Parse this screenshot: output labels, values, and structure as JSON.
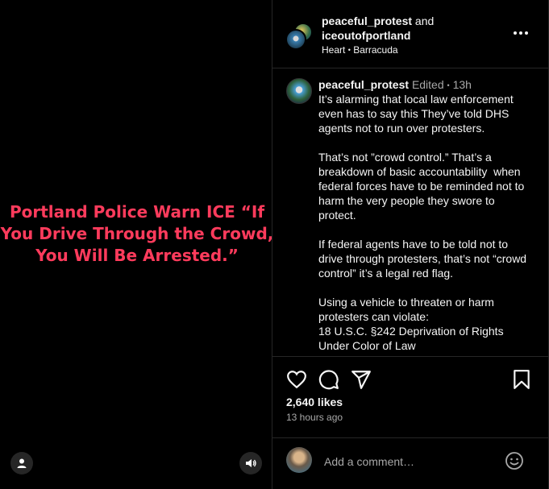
{
  "media": {
    "headline": "Portland Police Warn ICE “If You Drive Through the Crowd, You Will Be Arrested.”",
    "headline_color": "#ff3b5c",
    "icons": [
      "user-tag-icon",
      "speaker-icon"
    ]
  },
  "header": {
    "user1": "peaceful_protest",
    "joiner": " and",
    "user2": "iceoutofportland",
    "audio_artist": "Heart",
    "separator": "•",
    "audio_track": "Barracuda",
    "more_label": "•••"
  },
  "caption": {
    "username": "peaceful_protest",
    "edited": "Edited",
    "dot": "•",
    "age": "13h",
    "text": "It’s alarming that local law enforcement even has to say this They’ve told DHS agents not to run over protesters.\n\nThat’s not ”crowd control.” That’s a breakdown of basic accountability  when federal forces have to be reminded not to harm the very people they swore to protect.\n\nIf federal agents have to be told not to drive through protesters, that’s not “crowd control” it’s a legal red flag.\n\nUsing a vehicle to threaten or harm protesters can violate:\n18 U.S.C. §242 Deprivation of Rights Under Color of Law\n"
  },
  "actions": {
    "icons": [
      "heart-icon",
      "comment-icon",
      "share-icon",
      "bookmark-icon"
    ],
    "likes": "2,640 likes",
    "time": "13 hours ago"
  },
  "comment": {
    "placeholder": "Add a comment…"
  }
}
